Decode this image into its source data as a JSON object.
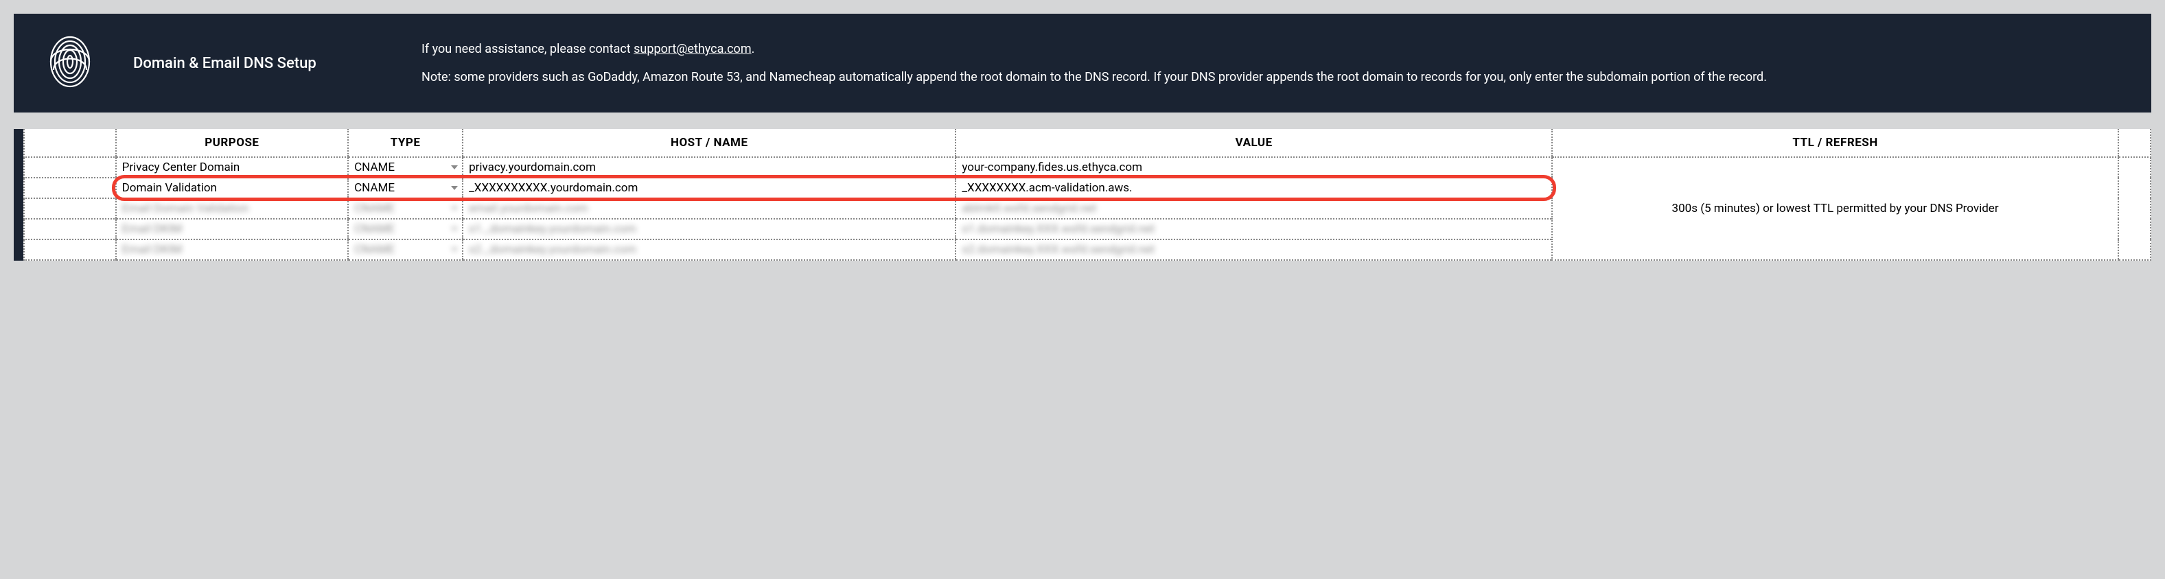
{
  "header": {
    "title": "Domain & Email DNS Setup",
    "assistance_prefix": "If you need assistance, please contact ",
    "assistance_link_text": "support@ethyca.com",
    "assistance_suffix": ".",
    "note": "Note: some providers such as GoDaddy, Amazon Route 53, and Namecheap automatically append the root domain to the DNS record. If your DNS provider appends the root domain to records for you, only enter the subdomain portion of the record."
  },
  "columns": {
    "purpose": "PURPOSE",
    "type": "TYPE",
    "host": "HOST / NAME",
    "value": "VALUE",
    "ttl": "TTL / REFRESH"
  },
  "rows": [
    {
      "purpose": "Privacy Center Domain",
      "type": "CNAME",
      "host": "privacy.yourdomain.com",
      "value": "your-company.fides.us.ethyca.com",
      "blurred": false
    },
    {
      "purpose": "Domain Validation",
      "type": "CNAME",
      "host": "_XXXXXXXXXX.yourdomain.com",
      "value": "_XXXXXXXX.acm-validation.aws.",
      "blurred": false
    },
    {
      "purpose": "Email Domain Validation",
      "type": "CNAME",
      "host": "email.yourdomain.com",
      "value": "ablmktl.wsfd.sendgrid.net",
      "blurred": true
    },
    {
      "purpose": "Email DKIM",
      "type": "CNAME",
      "host": "s1._domainkey.yourdomain.com",
      "value": "s1.domainkey.XXX.wsfd.sendgrid.net",
      "blurred": true
    },
    {
      "purpose": "Email DKIM",
      "type": "CNAME",
      "host": "s2._domainkey.yourdomain.com",
      "value": "s2.domainkey.XXX.wsfd.sendgrid.net",
      "blurred": true
    }
  ],
  "ttl_text": "300s (5 minutes) or lowest TTL permitted by your DNS Provider"
}
